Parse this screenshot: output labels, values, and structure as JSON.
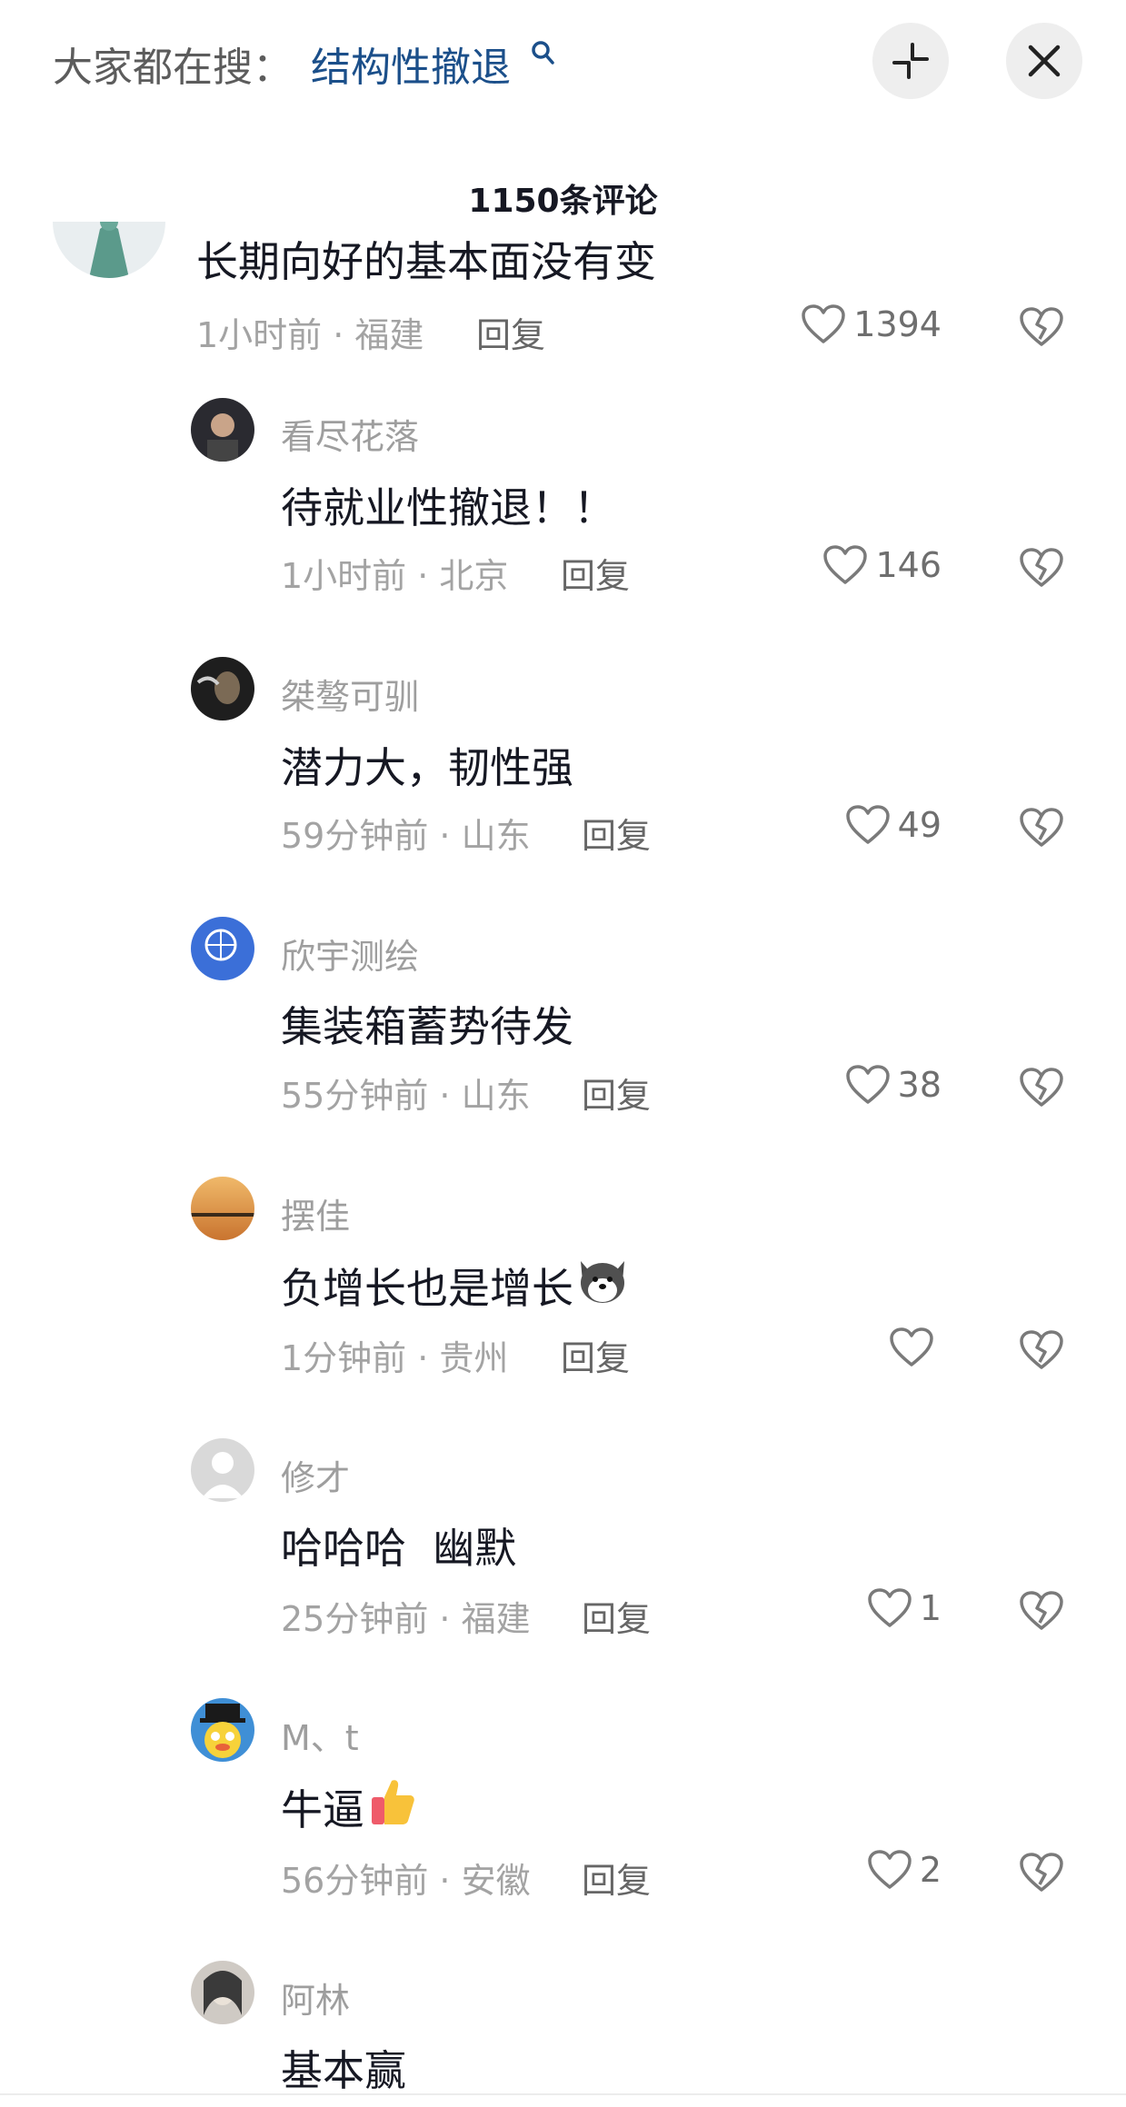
{
  "header": {
    "search_prefix": "大家都在搜：",
    "search_term": "结构性撤退",
    "icons": {
      "search": "search-icon",
      "collapse": "collapse-icon",
      "close": "close-icon"
    }
  },
  "comment_count": "1150条评论",
  "comments": [
    {
      "author": "",
      "text": "长期向好的基本面没有变",
      "time_location": "1小时前 · 福建",
      "reply": "回复",
      "likes": "1394"
    },
    {
      "author": "看尽花落",
      "text": "待就业性撤退！！",
      "time_location": "1小时前 · 北京",
      "reply": "回复",
      "likes": "146"
    },
    {
      "author": "桀骜可驯",
      "text": "潜力大，韧性强",
      "time_location": "59分钟前 · 山东",
      "reply": "回复",
      "likes": "49"
    },
    {
      "author": "欣宇测绘",
      "text": "集装箱蓄势待发",
      "time_location": "55分钟前 · 山东",
      "reply": "回复",
      "likes": "38"
    },
    {
      "author": "摆佳",
      "text": "负增长也是增长",
      "emoji": "dog-face-emoji",
      "time_location": "1分钟前 · 贵州",
      "reply": "回复",
      "likes": ""
    },
    {
      "author": "修才",
      "text": "哈哈哈  幽默",
      "time_location": "25分钟前 · 福建",
      "reply": "回复",
      "likes": "1"
    },
    {
      "author": "M、t",
      "text": "牛逼",
      "emoji": "thumbs-up-emoji",
      "time_location": "56分钟前 · 安徽",
      "reply": "回复",
      "likes": "2"
    },
    {
      "author": "阿林",
      "text": "基本赢",
      "time_location": "",
      "reply": "",
      "likes": ""
    }
  ],
  "colors": {
    "search_term": "#1b4f8a",
    "meta": "#a3a3a3",
    "text": "#161823"
  }
}
